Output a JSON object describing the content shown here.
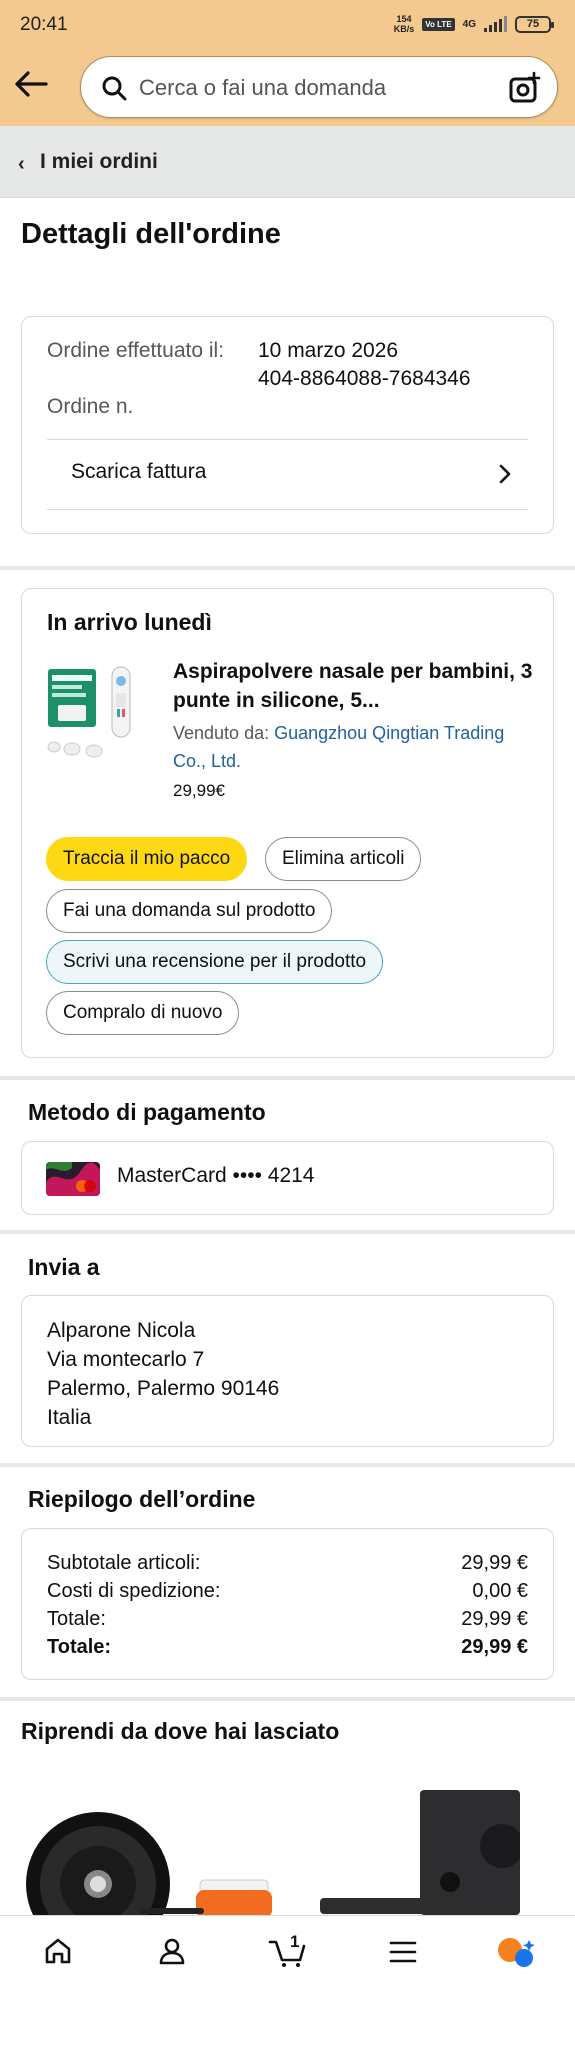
{
  "status": {
    "time": "20:41",
    "speed_value": "154",
    "speed_unit": "KB/s",
    "vo_label": "Vo LTE",
    "network": "4G",
    "battery": "75"
  },
  "search": {
    "placeholder": "Cerca o fai una domanda"
  },
  "breadcrumb": {
    "label": "I miei ordini"
  },
  "page": {
    "title": "Dettagli dell'ordine"
  },
  "order_info": {
    "date_label": "Ordine effettuato il:",
    "date_value": "10 marzo 2026",
    "number_label": "Ordine n.",
    "number_value": "404-8864088-7684346",
    "invoice_label": "Scarica fattura"
  },
  "shipment": {
    "status": "In arrivo lunedì",
    "product_title": "Aspirapolvere nasale per bambini, 3 punte in silicone, 5...",
    "sold_by_label": "Venduto da:",
    "seller_name": "Guangzhou Qingtian Trading Co., Ltd.",
    "price": "29,99€",
    "actions": {
      "track": "Traccia il mio pacco",
      "delete": "Elimina articoli",
      "ask": "Fai una domanda sul prodotto",
      "review": "Scrivi una recensione per il prodotto",
      "buy_again": "Compralo di nuovo"
    }
  },
  "payment": {
    "title": "Metodo di pagamento",
    "card": "MasterCard •••• 4214"
  },
  "shipping": {
    "title": "Invia a",
    "name": "Alparone Nicola",
    "street": "Via montecarlo 7",
    "city": "Palermo, Palermo 90146",
    "country": "Italia"
  },
  "summary": {
    "title": "Riepilogo dell’ordine",
    "rows": [
      {
        "label": "Subtotale articoli:",
        "value": "29,99 €"
      },
      {
        "label": "Costi di spedizione:",
        "value": "0,00 €"
      },
      {
        "label": "Totale:",
        "value": "29,99 €"
      },
      {
        "label": "Totale:",
        "value": "29,99 €"
      }
    ]
  },
  "resume": {
    "title": "Riprendi da dove hai lasciato"
  },
  "nav": {
    "cart_count": "1"
  }
}
